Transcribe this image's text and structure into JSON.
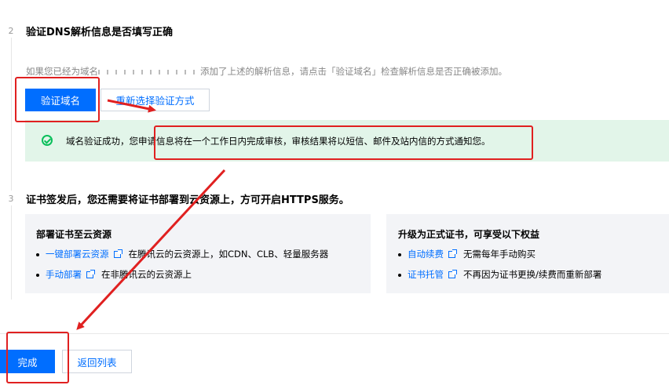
{
  "step2": {
    "number": "2",
    "title": "验证DNS解析信息是否填写正确",
    "hint_before": "如果您已经为域名",
    "hint_after": "添加了上述的解析信息，请点击「验证域名」检查解析信息是否正确被添加。",
    "verify_button": "验证域名",
    "reselect_button": "重新选择验证方式",
    "success_message": "域名验证成功，您申请信息将在一个工作日内完成审核，审核结果将以短信、邮件及站内信的方式通知您。"
  },
  "step3": {
    "number": "3",
    "title": "证书签发后，您还需要将证书部署到云资源上，方可开启HTTPS服务。",
    "deploy_card": {
      "title": "部署证书至云资源",
      "items": [
        {
          "link": "一键部署云资源",
          "desc": "在腾讯云的云资源上，如CDN、CLB、轻量服务器"
        },
        {
          "link": "手动部署",
          "desc": "在非腾讯云的云资源上"
        }
      ]
    },
    "upgrade_card": {
      "title": "升级为正式证书，可享受以下权益",
      "items": [
        {
          "link": "自动续费",
          "desc": "无需每年手动购买"
        },
        {
          "link": "证书托管",
          "desc": "不再因为证书更换/续费而重新部署"
        }
      ]
    }
  },
  "footer": {
    "done_button": "完成",
    "back_button": "返回列表"
  },
  "colors": {
    "primary": "#006eff",
    "success_bg": "#e2f5e9",
    "success_icon": "#0abf5b",
    "annotation": "#e02020"
  }
}
